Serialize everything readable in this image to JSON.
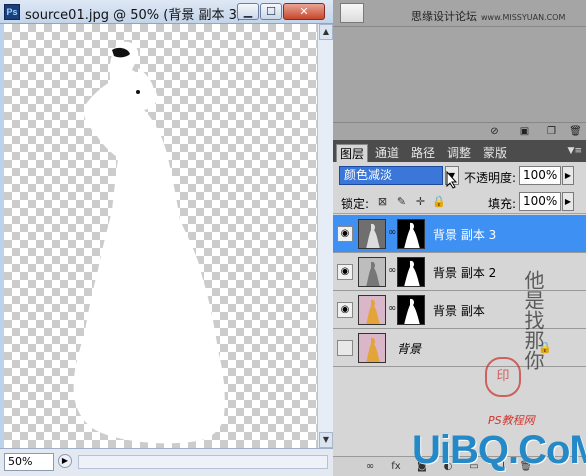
{
  "document": {
    "title": "source01.jpg @ 50% (背景 副本 3, ...",
    "app_icon": "Ps",
    "zoom": "50%",
    "buttons": {
      "minimize": "▁",
      "maximize": "☐",
      "close": "✕"
    }
  },
  "top_panel": {
    "site_text": "思缘设计论坛",
    "site_url": "www.MISSYUAN.COM"
  },
  "layers_panel": {
    "tabs": [
      "图层",
      "通道",
      "路径",
      "调整",
      "蒙版"
    ],
    "active_tab": "图层",
    "blend_mode": "颜色减淡",
    "opacity_label": "不透明度:",
    "opacity": "100%",
    "lock_label": "锁定:",
    "fill_label": "填充:",
    "fill": "100%",
    "layers": [
      {
        "name": "背景 副本 3",
        "selected": true,
        "visible": true,
        "has_mask": true
      },
      {
        "name": "背景 副本 2",
        "selected": false,
        "visible": true,
        "has_mask": true
      },
      {
        "name": "背景 副本",
        "selected": false,
        "visible": true,
        "has_mask": true
      },
      {
        "name": "背景",
        "selected": false,
        "visible": false,
        "has_mask": false,
        "locked": true
      }
    ]
  },
  "watermarks": {
    "calligraphy": "他是找那你",
    "seal": "印",
    "ps_text": "PS教程网",
    "brand": "UiBQ.CoM"
  }
}
